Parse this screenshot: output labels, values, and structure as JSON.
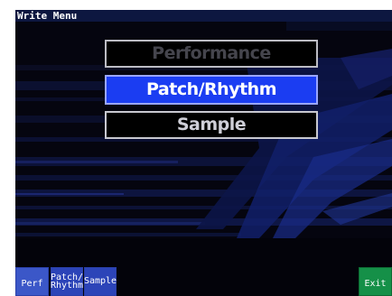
{
  "window": {
    "title": "Write Menu"
  },
  "menu": {
    "items": [
      {
        "label": "Performance",
        "state": "disabled"
      },
      {
        "label": "Patch/Rhythm",
        "state": "selected"
      },
      {
        "label": "Sample",
        "state": "normal"
      }
    ]
  },
  "softkeys": {
    "perf": "Perf",
    "patch_line1": "Patch/",
    "patch_line2": "Rhythm",
    "sample": "Sample",
    "exit": "Exit"
  },
  "colors": {
    "title_bar": "#0d1740",
    "selected_item": "#1b3df2",
    "softkey_blue": "#2c44b8",
    "exit_green": "#159048",
    "display_background": "#05050f"
  }
}
